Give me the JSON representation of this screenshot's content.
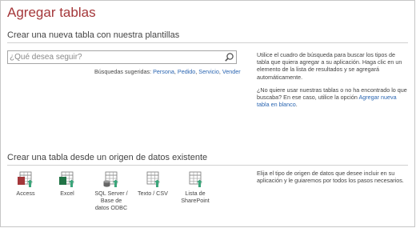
{
  "page": {
    "title": "Agregar tablas"
  },
  "templates": {
    "heading": "Crear una nueva tabla con nuestra plantillas",
    "search": {
      "placeholder": "¿Qué desea seguir?",
      "value": ""
    },
    "suggested_label": "Búsquedas sugeridas:",
    "suggested": [
      {
        "label": "Persona",
        "sep": ", "
      },
      {
        "label": "Pedido",
        "sep": ", "
      },
      {
        "label": "Servicio",
        "sep": ", "
      },
      {
        "label": "Vender",
        "sep": ""
      }
    ],
    "help1": "Utilice el cuadro de búsqueda para buscar los tipos de tabla que quiera agregar a su aplicación. Haga clic en un elemento de la lista de resultados y se agregará automáticamente.",
    "help2_text": "¿No quiere usar nuestras tablas o no ha encontrado lo que buscaba? En ese caso, utilice la opción ",
    "help2_link": "Agregar nueva tabla en blanco",
    "help2_end": "."
  },
  "existing": {
    "heading": "Crear una tabla desde un origen de datos existente",
    "help": "Elija el tipo de origen de datos que desee incluir en su aplicación y le guiaremos por todos los pasos necesarios.",
    "sources": [
      {
        "label": "Access",
        "icon": "access-icon",
        "accent": "#a4373a"
      },
      {
        "label": "Excel",
        "icon": "excel-icon",
        "accent": "#217346"
      },
      {
        "label": "SQL Server /\nBase de\ndatos ODBC",
        "icon": "sql-server-icon",
        "accent": "#3a3a3a"
      },
      {
        "label": "Texto / CSV",
        "icon": "text-csv-icon",
        "accent": "#3a3a3a"
      },
      {
        "label": "Lista de\nSharePoint",
        "icon": "sharepoint-icon",
        "accent": "#3a3a3a"
      }
    ]
  },
  "colors": {
    "title": "#a4373a",
    "link": "#2a65b1",
    "arrow": "#3aa57a"
  }
}
